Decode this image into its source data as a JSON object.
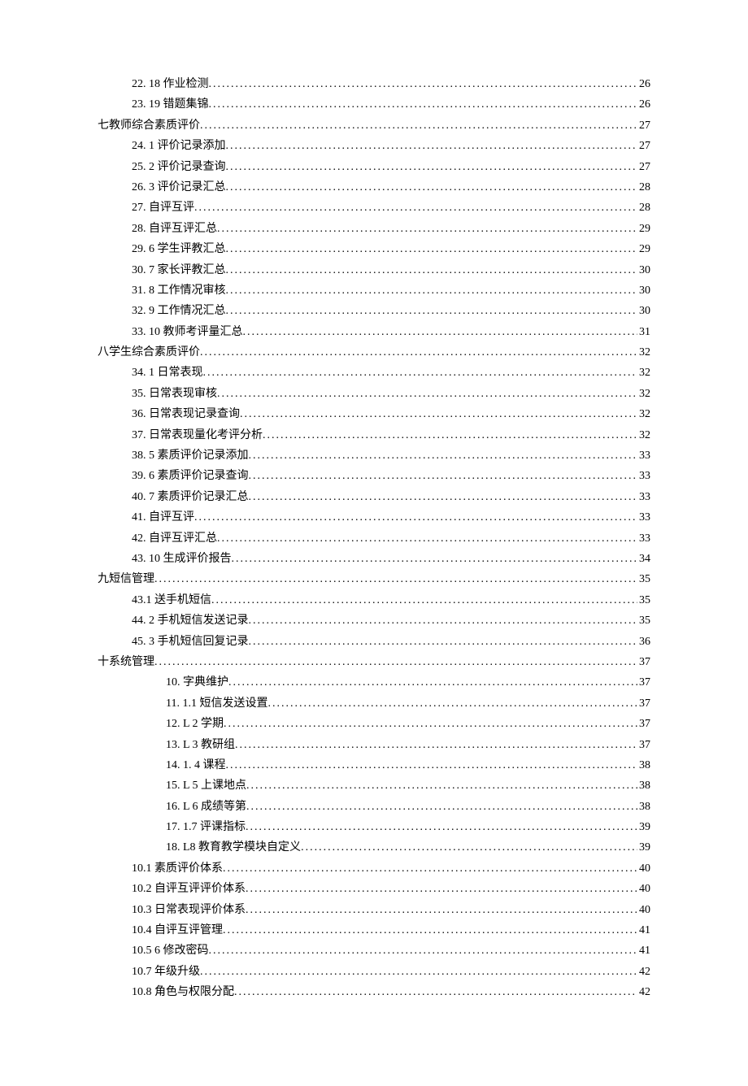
{
  "toc": [
    {
      "level": 2,
      "text": "22. 18 作业检测",
      "page": "26"
    },
    {
      "level": 2,
      "text": "23. 19 错题集锦",
      "page": "26"
    },
    {
      "level": 1,
      "text": "七教师综合素质评价",
      "page": "27"
    },
    {
      "level": 2,
      "text": "24. 1 评价记录添加",
      "page": "27"
    },
    {
      "level": 2,
      "text": "25. 2 评价记录查询",
      "page": "27"
    },
    {
      "level": 2,
      "text": "26. 3 评价记录汇总",
      "page": "28"
    },
    {
      "level": 2,
      "text": "27.    自评互评",
      "page": "28"
    },
    {
      "level": 2,
      "text": "28.    自评互评汇总",
      "page": "29"
    },
    {
      "level": 2,
      "text": "29. 6 学生评教汇总",
      "page": "29"
    },
    {
      "level": 2,
      "text": "30. 7 家长评教汇总",
      "page": "30"
    },
    {
      "level": 2,
      "text": "31. 8 工作情况审核",
      "page": "30"
    },
    {
      "level": 2,
      "text": "32. 9 工作情况汇总",
      "page": "30"
    },
    {
      "level": 2,
      "text": "33. 10 教师考评量汇总",
      "page": "31"
    },
    {
      "level": 1,
      "text": "八学生综合素质评价",
      "page": "32"
    },
    {
      "level": 2,
      "text": "34. 1 日常表现",
      "page": "32"
    },
    {
      "level": 2,
      "text": "35.    日常表现审核",
      "page": "32"
    },
    {
      "level": 2,
      "text": "36.    日常表现记录查询",
      "page": "32"
    },
    {
      "level": 2,
      "text": "37.    日常表现量化考评分析",
      "page": "32"
    },
    {
      "level": 2,
      "text": "38. 5 素质评价记录添加",
      "page": "33"
    },
    {
      "level": 2,
      "text": "39. 6 素质评价记录查询",
      "page": "33"
    },
    {
      "level": 2,
      "text": "40. 7 素质评价记录汇总",
      "page": "33"
    },
    {
      "level": 2,
      "text": "41.    自评互评",
      "page": "33"
    },
    {
      "level": 2,
      "text": "42.    自评互评汇总",
      "page": "33"
    },
    {
      "level": 2,
      "text": "43. 10 生成评价报告",
      "page": "34"
    },
    {
      "level": 1,
      "text": "九短信管理",
      "page": "35"
    },
    {
      "level": 2,
      "text": "43.1      送手机短信",
      "page": "35"
    },
    {
      "level": 2,
      "text": "44. 2 手机短信发送记录",
      "page": "35"
    },
    {
      "level": 2,
      "text": "45. 3 手机短信回复记录",
      "page": "36"
    },
    {
      "level": 1,
      "text": "十系统管理",
      "page": "37"
    },
    {
      "level": 3,
      "text": "10.    字典维护",
      "page": "37"
    },
    {
      "level": 3,
      "text": "11.    1.1 短信发送设置",
      "page": "37"
    },
    {
      "level": 3,
      "text": "12.    L 2 学期",
      "page": "37"
    },
    {
      "level": 3,
      "text": "13.    L 3 教研组",
      "page": "37"
    },
    {
      "level": 3,
      "text": "14.    1. 4 课程",
      "page": "38"
    },
    {
      "level": 3,
      "text": "15.    L 5 上课地点",
      "page": "38"
    },
    {
      "level": 3,
      "text": "16.    L 6 成绩等第",
      "page": "38"
    },
    {
      "level": 3,
      "text": "17.    1.7 评课指标",
      "page": "39"
    },
    {
      "level": 3,
      "text": "18.    L8 教育教学模块自定义",
      "page": "39"
    },
    {
      "level": 2,
      "text": "10.1      素质评价体系",
      "page": "40"
    },
    {
      "level": 2,
      "text": "10.2      自评互评评价体系",
      "page": "40"
    },
    {
      "level": 2,
      "text": "10.3      日常表现评价体系",
      "page": "40"
    },
    {
      "level": 2,
      "text": "10.4      自评互评管理",
      "page": "41"
    },
    {
      "level": 2,
      "text": "10.5 6 修改密码",
      "page": "41"
    },
    {
      "level": 2,
      "text": "10.7 年级升级",
      "page": "42"
    },
    {
      "level": 2,
      "text": "10.8 角色与权限分配",
      "page": "42"
    }
  ]
}
